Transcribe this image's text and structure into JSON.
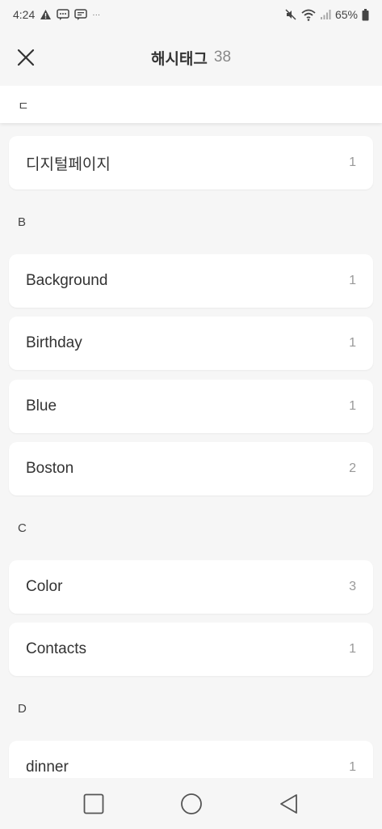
{
  "status_bar": {
    "time": "4:24",
    "battery": "65%",
    "more_dots": "···"
  },
  "header": {
    "title": "해시태그",
    "count": "38"
  },
  "sticky_section": "ㄷ",
  "sections": [
    {
      "letter": "B"
    },
    {
      "letter": "C"
    },
    {
      "letter": "D"
    }
  ],
  "tags": [
    {
      "name": "디지털페이지",
      "count": "1"
    },
    {
      "name": "Background",
      "count": "1"
    },
    {
      "name": "Birthday",
      "count": "1"
    },
    {
      "name": "Blue",
      "count": "1"
    },
    {
      "name": "Boston",
      "count": "2"
    },
    {
      "name": "Color",
      "count": "3"
    },
    {
      "name": "Contacts",
      "count": "1"
    },
    {
      "name": "dinner",
      "count": "1"
    }
  ],
  "colors": {
    "background": "#f6f6f6",
    "card": "#ffffff",
    "text": "#333333",
    "muted": "#999999"
  }
}
